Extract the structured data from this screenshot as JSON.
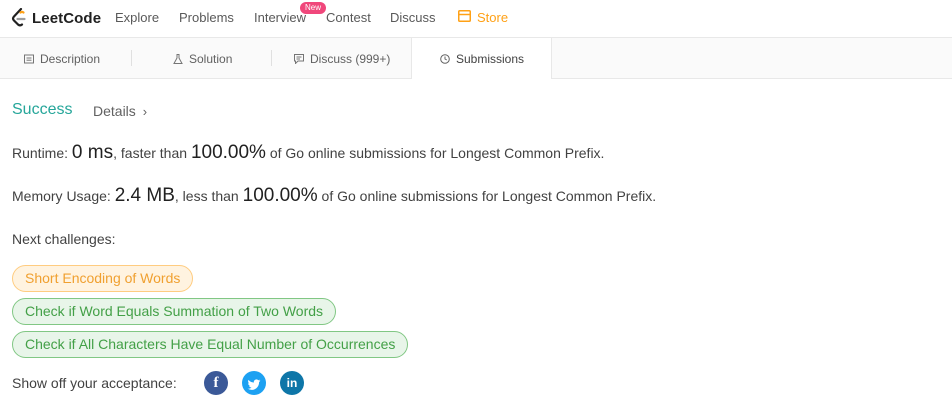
{
  "nav": {
    "brand": "LeetCode",
    "items": [
      "Explore",
      "Problems",
      "Interview",
      "Contest",
      "Discuss",
      "Store"
    ],
    "badge": "New",
    "accent": "#ffa116"
  },
  "tabs": [
    {
      "label": "Description",
      "icon": "document-icon"
    },
    {
      "label": "Solution",
      "icon": "flask-icon"
    },
    {
      "label": "Discuss (999+)",
      "icon": "comment-icon"
    },
    {
      "label": "Submissions",
      "icon": "clock-icon",
      "active": true
    }
  ],
  "result": {
    "status": "Success",
    "details_label": "Details",
    "runtime_label": "Runtime:",
    "runtime_value": "0 ms",
    "runtime_mid": ", faster than",
    "runtime_pct": "100.00%",
    "runtime_tail": "of Go online submissions for Longest Common Prefix.",
    "memory_label": "Memory Usage:",
    "memory_value": "2.4 MB",
    "memory_mid": ", less than",
    "memory_pct": "100.00%",
    "memory_tail": "of Go online submissions for Longest Common Prefix."
  },
  "next": {
    "label": "Next challenges:",
    "challenges": [
      {
        "title": "Short Encoding of Words",
        "difficulty": "medium"
      },
      {
        "title": "Check if Word Equals Summation of Two Words",
        "difficulty": "easy"
      },
      {
        "title": "Check if All Characters Have Equal Number of Occurrences",
        "difficulty": "easy"
      }
    ]
  },
  "share": {
    "label": "Show off your acceptance:",
    "networks": [
      {
        "name": "facebook",
        "glyph": "f",
        "color": "#3b5998"
      },
      {
        "name": "twitter",
        "glyph": "t",
        "color": "#1da1f2"
      },
      {
        "name": "linkedin",
        "glyph": "in",
        "color": "#0e76a8"
      }
    ]
  }
}
